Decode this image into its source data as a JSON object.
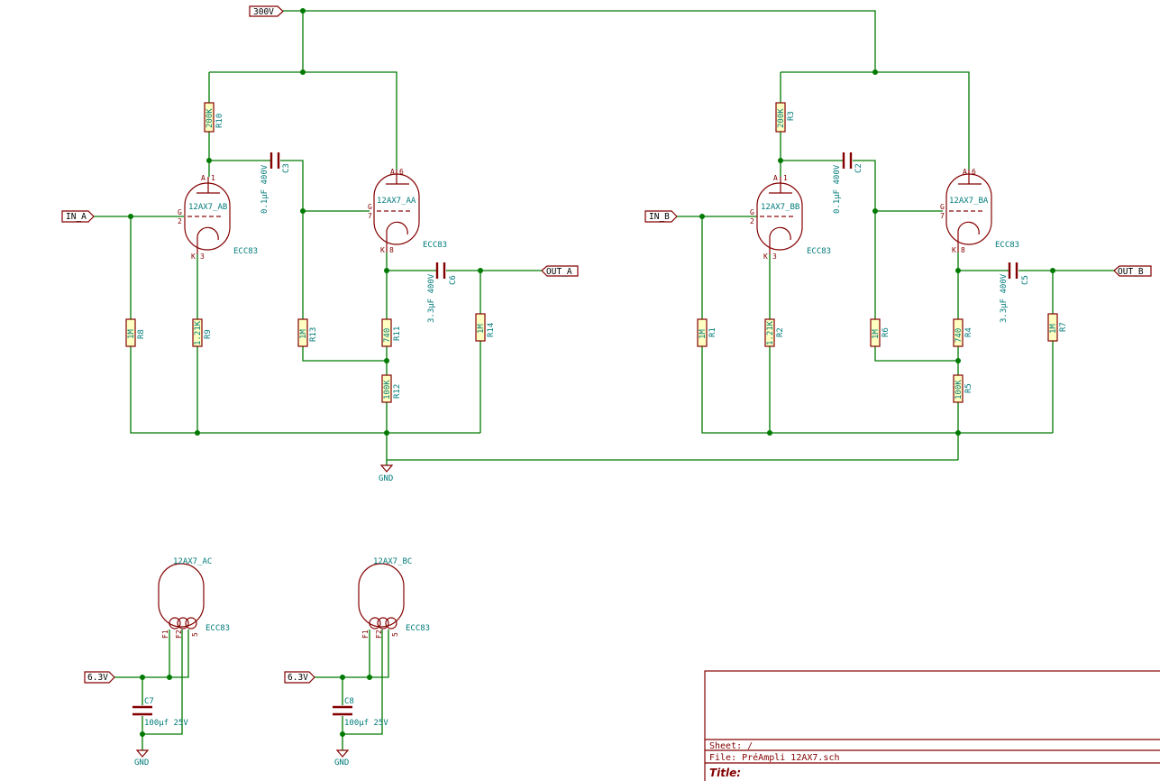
{
  "labels": {
    "b_plus": "300V",
    "in_a": "IN_A",
    "in_b": "IN_B",
    "out_a": "OUT_A",
    "out_b": "OUT_B",
    "heat_a": "6.3V",
    "heat_b": "6.3V",
    "gnd": "GND"
  },
  "resistors": {
    "R10": {
      "ref": "R10",
      "value": "200K"
    },
    "R8": {
      "ref": "R8",
      "value": "1M"
    },
    "R9": {
      "ref": "R9",
      "value": "1.21K"
    },
    "R13": {
      "ref": "R13",
      "value": "1M"
    },
    "R11": {
      "ref": "R11",
      "value": "740"
    },
    "R12": {
      "ref": "R12",
      "value": "100K"
    },
    "R14": {
      "ref": "R14",
      "value": "1M"
    },
    "R3": {
      "ref": "R3",
      "value": "200K"
    },
    "R1": {
      "ref": "R1",
      "value": "1M"
    },
    "R2": {
      "ref": "R2",
      "value": "1.21K"
    },
    "R6": {
      "ref": "R6",
      "value": "1M"
    },
    "R4": {
      "ref": "R4",
      "value": "740"
    },
    "R5": {
      "ref": "R5",
      "value": "100K"
    },
    "R7": {
      "ref": "R7",
      "value": "1M"
    }
  },
  "capacitors": {
    "C3": {
      "ref": "C3",
      "value": "0.1µF 400V"
    },
    "C6": {
      "ref": "C6",
      "value": "3.3µF 400V"
    },
    "C2": {
      "ref": "C2",
      "value": "0.1µF 400V"
    },
    "C5": {
      "ref": "C5",
      "value": "3.3µF 400V"
    },
    "C7": {
      "ref": "C7",
      "value": "100µf 25V"
    },
    "C8": {
      "ref": "C8",
      "value": "100µf 25V"
    }
  },
  "tubes": {
    "AB": {
      "ref": "12AX7_AB",
      "value": "ECC83",
      "pin_a": "1",
      "pin_g": "2",
      "pin_k": "3"
    },
    "AA": {
      "ref": "12AX7_AA",
      "value": "ECC83",
      "pin_a": "6",
      "pin_g": "7",
      "pin_k": "8"
    },
    "BB": {
      "ref": "12AX7_BB",
      "value": "ECC83",
      "pin_a": "1",
      "pin_g": "2",
      "pin_k": "3"
    },
    "BA": {
      "ref": "12AX7_BA",
      "value": "ECC83",
      "pin_a": "6",
      "pin_g": "7",
      "pin_k": "8"
    },
    "AC": {
      "ref": "12AX7_AC",
      "value": "ECC83"
    },
    "BC": {
      "ref": "12AX7_BC",
      "value": "ECC83"
    }
  },
  "pin_letters": {
    "anode": "A",
    "grid": "G",
    "cathode": "K",
    "f1": "F1",
    "f2": "F2",
    "fc": "5"
  },
  "title_block": {
    "sheet": "Sheet: /",
    "file": "File: PréAmpli 12AX7.sch",
    "title": "Title:"
  }
}
